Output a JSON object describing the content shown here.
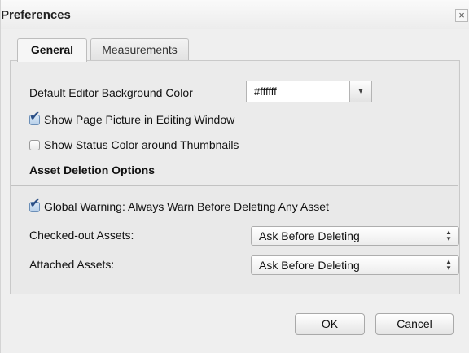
{
  "dialog": {
    "title": "Preferences",
    "close_symbol": "×"
  },
  "tabs": [
    {
      "label": "General",
      "active": true
    },
    {
      "label": "Measurements",
      "active": false
    }
  ],
  "general": {
    "bg_color_label": "Default Editor Background Color",
    "bg_color_value": "#ffffff",
    "dropdown_symbol": "▾",
    "show_page_picture": {
      "label": "Show Page Picture in Editing Window",
      "checked": true
    },
    "show_status_color": {
      "label": "Show Status Color around Thumbnails",
      "checked": false
    },
    "asset_deletion_heading": "Asset Deletion Options",
    "global_warning": {
      "label": "Global Warning: Always Warn Before Deleting Any Asset",
      "checked": true
    },
    "checked_out_assets": {
      "label": "Checked-out Assets:",
      "value": "Ask Before Deleting"
    },
    "attached_assets": {
      "label": "Attached Assets:",
      "value": "Ask Before Deleting"
    }
  },
  "buttons": {
    "ok": "OK",
    "cancel": "Cancel"
  },
  "icons": {
    "close": "close-icon",
    "checkmark": "checkmark-icon",
    "dropdown": "chevron-down-icon",
    "select_arrows": "updown-arrows-icon"
  },
  "colors": {
    "accent_check": "#2b4f86",
    "panel_bg": "#e9e9e9"
  }
}
